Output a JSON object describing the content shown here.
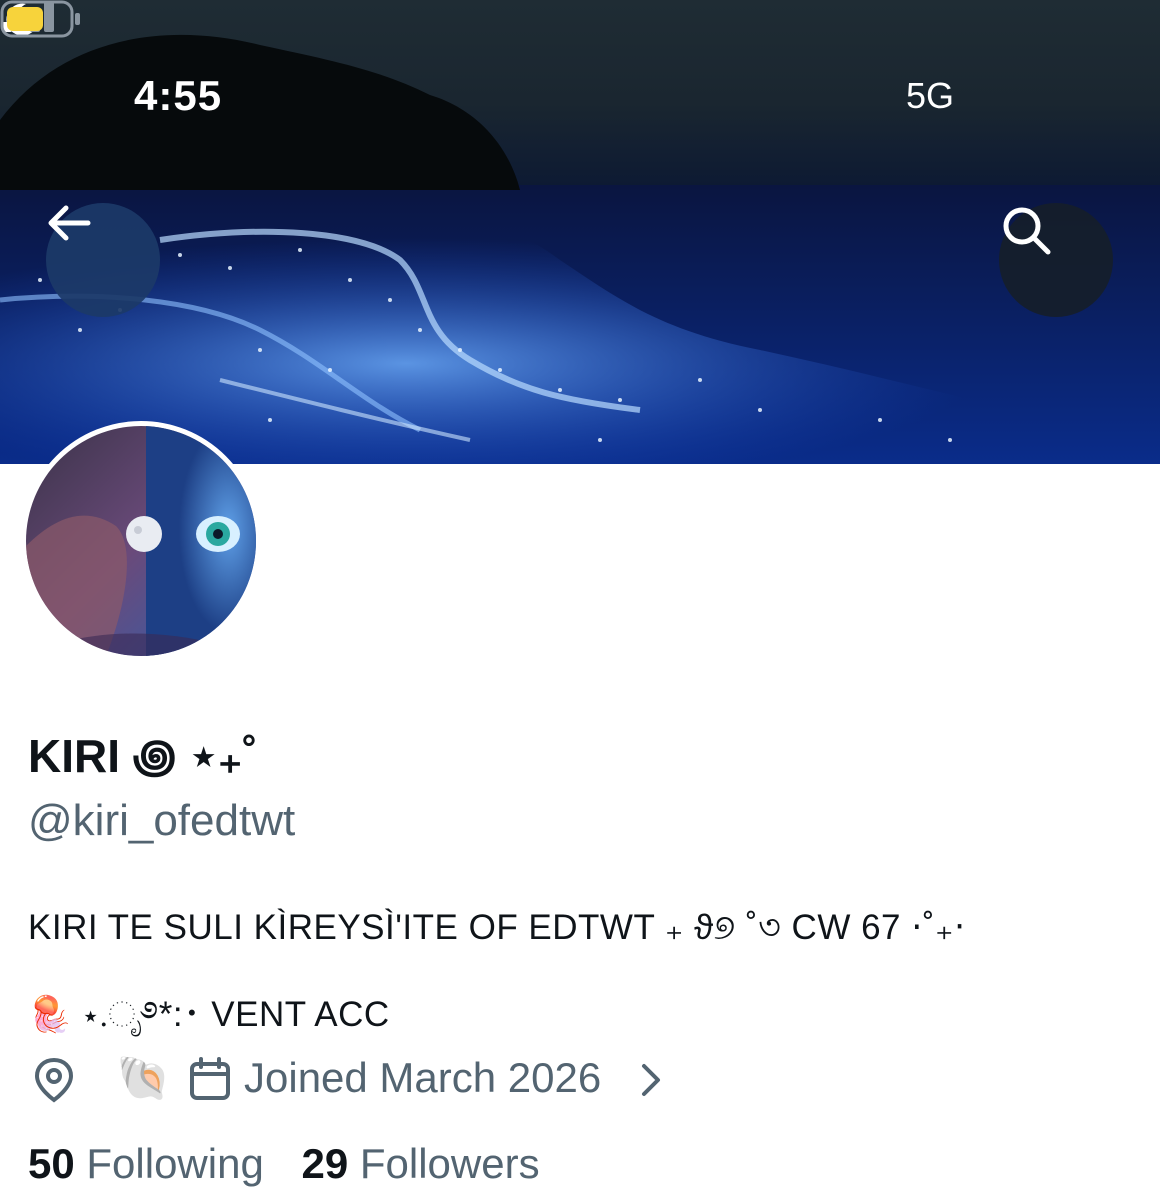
{
  "status_bar": {
    "time": "4:55",
    "network": "5G",
    "icons": [
      "moon-icon",
      "signal-icon",
      "battery-icon"
    ],
    "battery_color": "#f7d33b"
  },
  "header": {
    "back_icon": "arrow-left-icon",
    "search_icon": "search-icon"
  },
  "profile": {
    "display_name": "KIRI ꩜ ⋆₊˚",
    "handle": "@kiri_ofedtwt",
    "bio_line1": "KIRI TE SULI KÌREYSÌ'ITE OF EDTWT ₊ ϑ୭ ˚৩ CW 67 ⋅˚₊‧",
    "bio_line2_emoji": "🪼",
    "bio_line2": "⋆.ೃ࿔*:･ VENT ACC",
    "location_emoji": "🐚",
    "joined": "Joined March 2026",
    "following_count": "50",
    "following_label": "Following",
    "followers_count": "29",
    "followers_label": "Followers"
  },
  "colors": {
    "text_primary": "#0f1419",
    "text_secondary": "#536471",
    "banner_accent": "#0b2a7a"
  }
}
